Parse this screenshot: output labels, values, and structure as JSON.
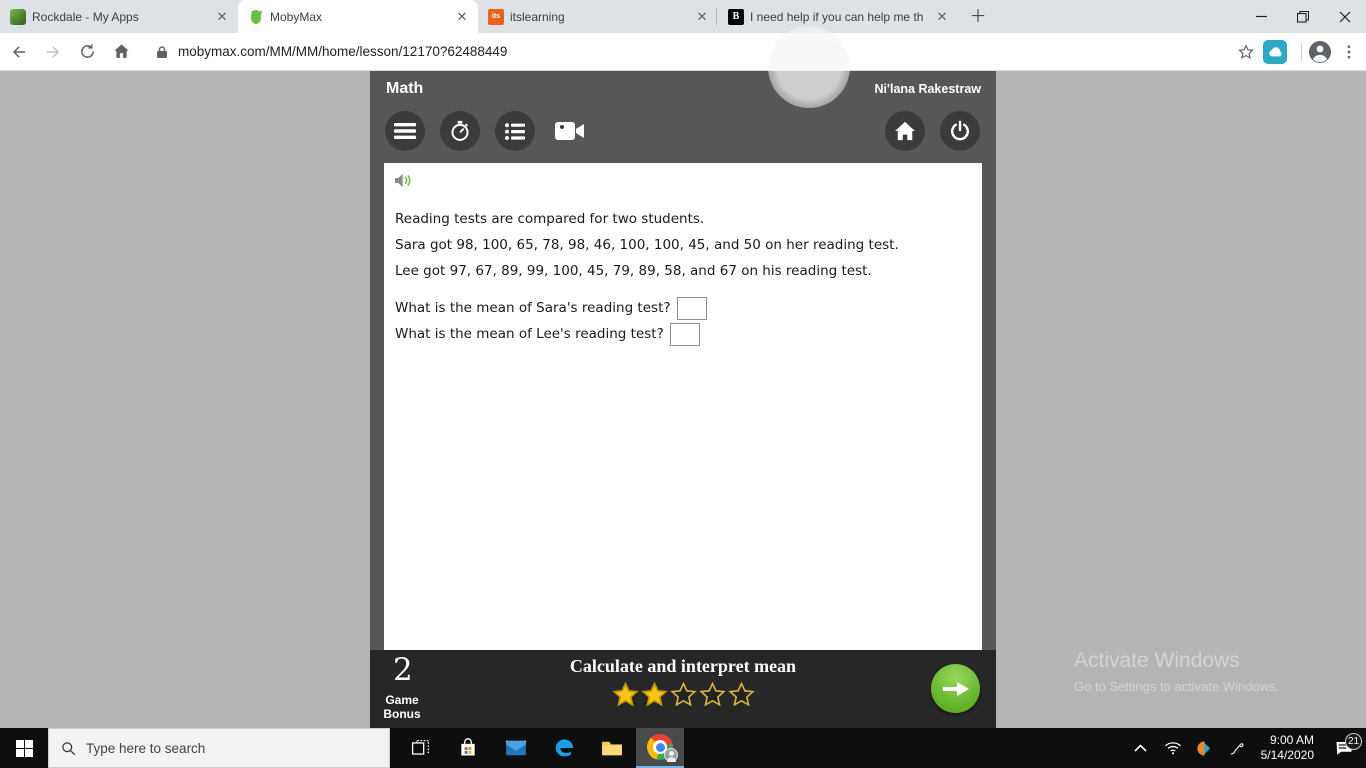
{
  "browser": {
    "tabs": [
      {
        "title": "Rockdale - My Apps",
        "favicon_text": ""
      },
      {
        "title": "MobyMax",
        "favicon_text": ""
      },
      {
        "title": "itslearning",
        "favicon_text": "its"
      },
      {
        "title": "I need help if you can help me th",
        "favicon_text": "B"
      }
    ],
    "url": "mobymax.com/MM/MM/home/lesson/12170?62488449"
  },
  "lesson": {
    "subject": "Math",
    "student_name": "Ni'lana Rakestraw",
    "problem": {
      "intro": "Reading tests are compared for two students.",
      "sara_line": "Sara got 98, 100, 65, 78, 98, 46, 100, 100, 45, and 50 on her reading test.",
      "lee_line": "Lee got 97, 67, 89, 99, 100, 45, 79, 89, 58, and 67 on his reading test.",
      "question1": "What is the mean of Sara's reading test?",
      "question2": "What is the mean of Lee's reading test?",
      "answer1": "",
      "answer2": ""
    },
    "footer": {
      "game_bonus_value": "2",
      "game_bonus_label": "Game\nBonus",
      "lesson_title": "Calculate and interpret mean",
      "stars_filled": 2,
      "stars_total": 5
    }
  },
  "watermark": {
    "line1": "Activate Windows",
    "line2": "Go to Settings to activate Windows."
  },
  "taskbar": {
    "search_placeholder": "Type here to search",
    "clock_time": "9:00 AM",
    "clock_date": "5/14/2020",
    "notification_count": "21"
  },
  "colors": {
    "panel_header": "#57575a",
    "panel_footer": "#272727",
    "star_gold": "#f5c518",
    "next_green": "#5fae25",
    "taskbar_accent": "#76b9ed",
    "page_background": "#b5b5b5"
  }
}
